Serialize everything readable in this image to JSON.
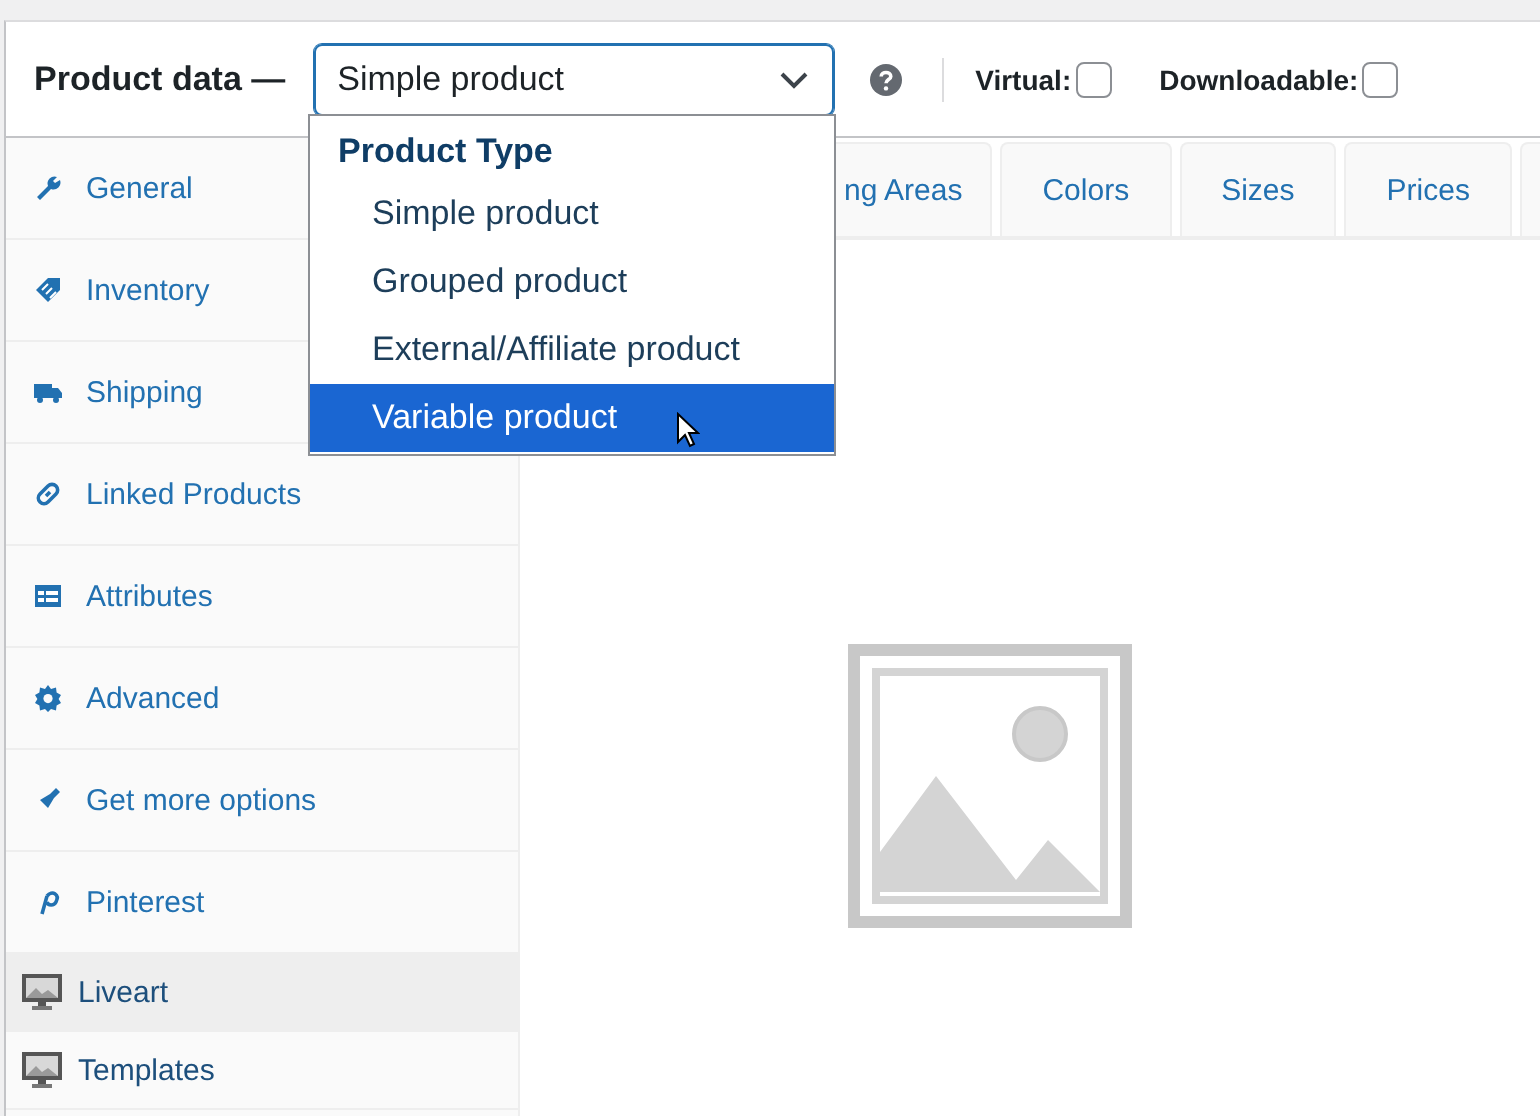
{
  "header": {
    "title": "Product data —",
    "product_type": {
      "value": "Simple product",
      "expanded": true
    },
    "checkboxes": [
      {
        "label": "Virtual:",
        "checked": false
      },
      {
        "label": "Downloadable:",
        "checked": false
      }
    ]
  },
  "dropdown": {
    "group": "Product Type",
    "options": [
      {
        "label": "Simple product",
        "selected": false
      },
      {
        "label": "Grouped product",
        "selected": false
      },
      {
        "label": "External/Affiliate product",
        "selected": false
      },
      {
        "label": "Variable product",
        "selected": true
      }
    ]
  },
  "sidebar": {
    "items": [
      {
        "label": "General",
        "kind": "tab",
        "selected": false
      },
      {
        "label": "Inventory",
        "kind": "tab",
        "selected": false
      },
      {
        "label": "Shipping",
        "kind": "tab",
        "selected": false
      },
      {
        "label": "Linked Products",
        "kind": "tab",
        "selected": false
      },
      {
        "label": "Attributes",
        "kind": "tab",
        "selected": false
      },
      {
        "label": "Advanced",
        "kind": "tab",
        "selected": false
      },
      {
        "label": "Get more options",
        "kind": "tab",
        "selected": false
      },
      {
        "label": "Pinterest",
        "kind": "tab",
        "selected": false
      },
      {
        "label": "Liveart",
        "kind": "plugin",
        "selected": true
      },
      {
        "label": "Templates",
        "kind": "plugin",
        "selected": false
      }
    ]
  },
  "tabs": [
    {
      "label": "ng Areas"
    },
    {
      "label": "Colors"
    },
    {
      "label": "Sizes"
    },
    {
      "label": "Prices"
    }
  ]
}
